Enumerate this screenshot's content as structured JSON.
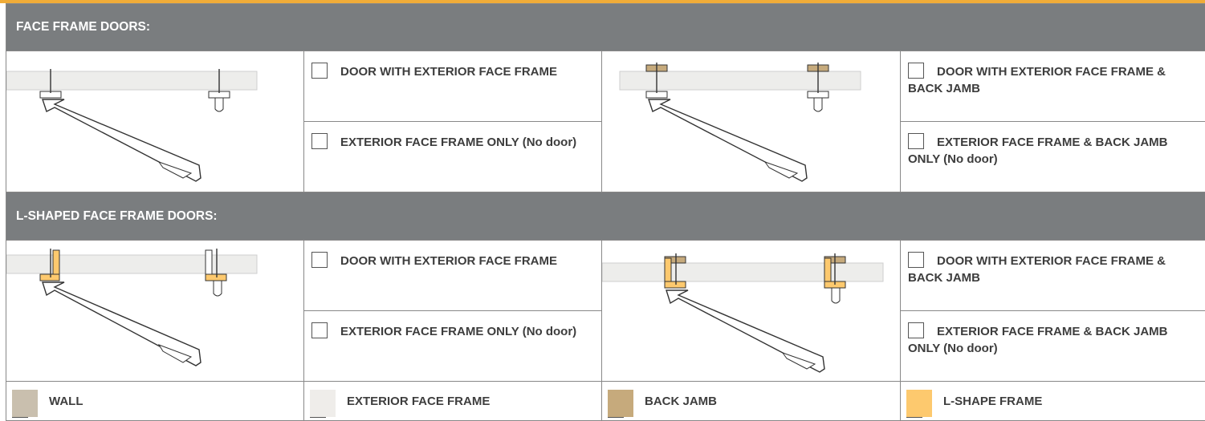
{
  "sections": [
    {
      "title": "FACE FRAME DOORS:",
      "options": {
        "standard_door": "DOOR WITH EXTERIOR FACE FRAME",
        "standard_frame_only": "EXTERIOR FACE FRAME ONLY (No door)",
        "backjamb_door": "DOOR WITH EXTERIOR FACE FRAME & BACK JAMB",
        "backjamb_frame_only": "EXTERIOR FACE FRAME & BACK JAMB ONLY (No door)"
      }
    },
    {
      "title": "L-SHAPED FACE FRAME DOORS:",
      "options": {
        "standard_door": "DOOR WITH EXTERIOR FACE FRAME",
        "standard_frame_only": "EXTERIOR FACE FRAME ONLY (No door)",
        "backjamb_door": "DOOR WITH EXTERIOR FACE FRAME & BACK JAMB",
        "backjamb_frame_only": "EXTERIOR FACE FRAME & BACK JAMB ONLY (No door)"
      }
    }
  ],
  "legend": [
    {
      "label": "WALL",
      "color": "#c9bfae"
    },
    {
      "label": "EXTERIOR FACE FRAME",
      "color": "#efedea"
    },
    {
      "label": "BACK JAMB",
      "color": "#c6aa7c"
    },
    {
      "label": "L-SHAPE FRAME",
      "color": "#fdc96e"
    }
  ],
  "colors": {
    "accent": "#f0ac38",
    "header_bg": "#7a7d7f",
    "wall": "#e8e8e6",
    "back_jamb": "#c6aa7c",
    "l_shape": "#fdc96e"
  }
}
